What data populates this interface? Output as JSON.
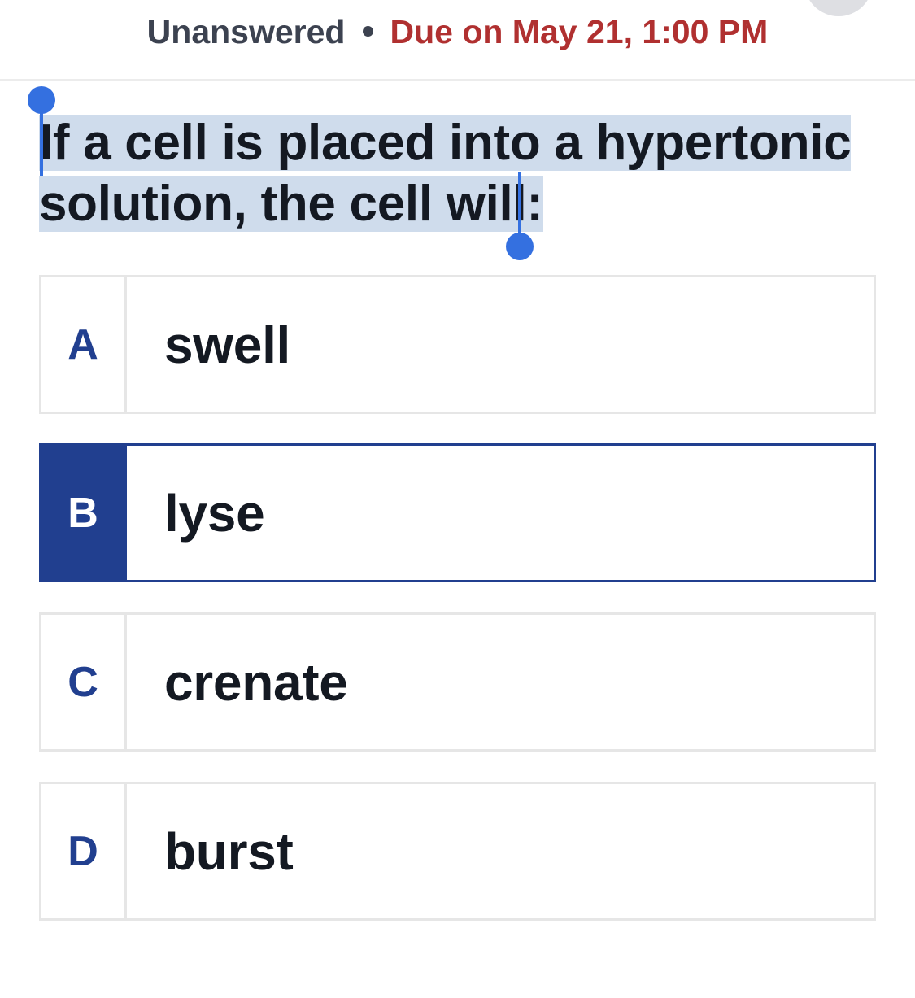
{
  "status": {
    "state": "Unanswered",
    "due": "Due on May 21, 1:00 PM"
  },
  "question": {
    "text": "If a cell is placed into a hypertonic solution, the cell will:"
  },
  "options": [
    {
      "letter": "A",
      "text": "swell",
      "selected": false
    },
    {
      "letter": "B",
      "text": "lyse",
      "selected": true
    },
    {
      "letter": "C",
      "text": "crenate",
      "selected": false
    },
    {
      "letter": "D",
      "text": "burst",
      "selected": false
    }
  ],
  "colors": {
    "accent": "#213f8f",
    "due": "#b03030",
    "selection_highlight": "#cfdcec",
    "selection_handle": "#3470e0"
  }
}
